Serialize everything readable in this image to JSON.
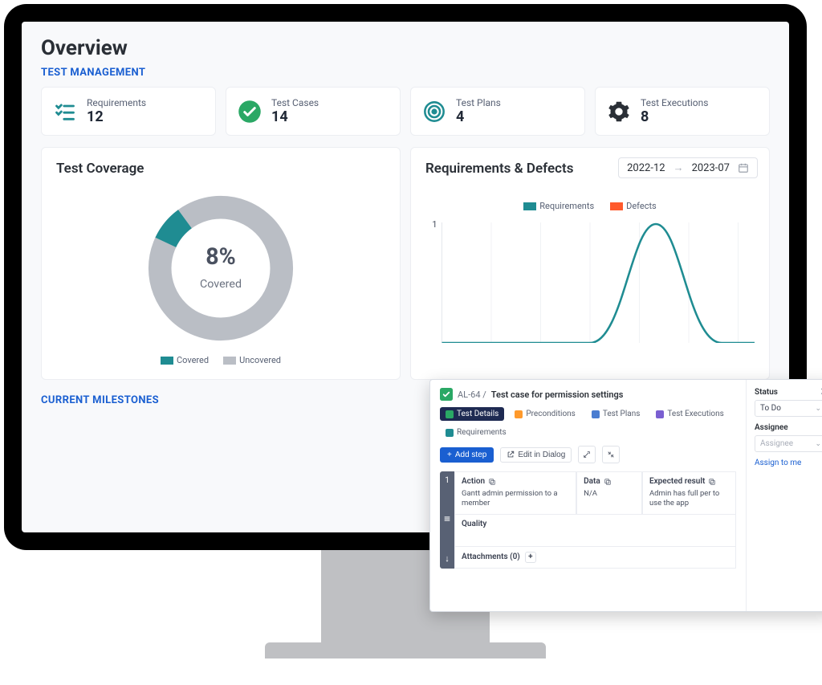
{
  "page": {
    "title": "Overview",
    "section_test_mgmt": "TEST MANAGEMENT",
    "section_milestones": "CURRENT MILESTONES"
  },
  "stats": {
    "requirements": {
      "label": "Requirements",
      "value": "12"
    },
    "test_cases": {
      "label": "Test Cases",
      "value": "14"
    },
    "test_plans": {
      "label": "Test Plans",
      "value": "4"
    },
    "test_execs": {
      "label": "Test Executions",
      "value": "8"
    }
  },
  "coverage": {
    "panel_title": "Test Coverage",
    "percent_label": "8%",
    "caption": "Covered",
    "legend_covered": "Covered",
    "legend_uncovered": "Uncovered"
  },
  "req_defects": {
    "panel_title": "Requirements & Defects",
    "date_from": "2022-12",
    "date_to": "2023-07",
    "legend_requirements": "Requirements",
    "legend_defects": "Defects",
    "y_tick": "1"
  },
  "chart_data": [
    {
      "type": "pie",
      "title": "Test Coverage",
      "series": [
        {
          "name": "Covered",
          "value": 8,
          "color": "#1f8c92"
        },
        {
          "name": "Uncovered",
          "value": 92,
          "color": "#babec5"
        }
      ]
    },
    {
      "type": "line",
      "title": "Requirements & Defects",
      "xlabel": "",
      "ylabel": "",
      "ylim": [
        0,
        1
      ],
      "x_range": [
        "2022-12",
        "2023-07"
      ],
      "series": [
        {
          "name": "Requirements",
          "color": "#1f8c92",
          "values": [
            0,
            0,
            0,
            0,
            0.3,
            1,
            0.3,
            0
          ]
        },
        {
          "name": "Defects",
          "color": "#ff5a2c",
          "values": []
        }
      ]
    }
  ],
  "dialog": {
    "icon_color": "#2aa865",
    "breadcrumb": "AL-64  /",
    "title": "Test case for permission settings",
    "tabs": {
      "details": "Test Details",
      "precond": "Preconditions",
      "plans": "Test Plans",
      "execs": "Test Executions",
      "reqs": "Requirements"
    },
    "toolbar": {
      "add_step": "Add step",
      "edit_dialog": "Edit in Dialog"
    },
    "step": {
      "num": "1",
      "action_head": "Action",
      "action_text": "Gantt admin permission to a member",
      "data_head": "Data",
      "data_text": "N/A",
      "expected_head": "Expected result",
      "expected_text": "Admin has full per to use the app",
      "quality": "Quality",
      "attachments": "Attachments (0)"
    },
    "side": {
      "status_label": "Status",
      "status_value": "To Do",
      "assignee_label": "Assignee",
      "assignee_placeholder": "Assignee",
      "assign_me": "Assign to me"
    }
  },
  "colors": {
    "teal": "#1f8c92",
    "grey": "#babec5",
    "orange": "#ff5a2c",
    "blue": "#1a5fd1"
  }
}
